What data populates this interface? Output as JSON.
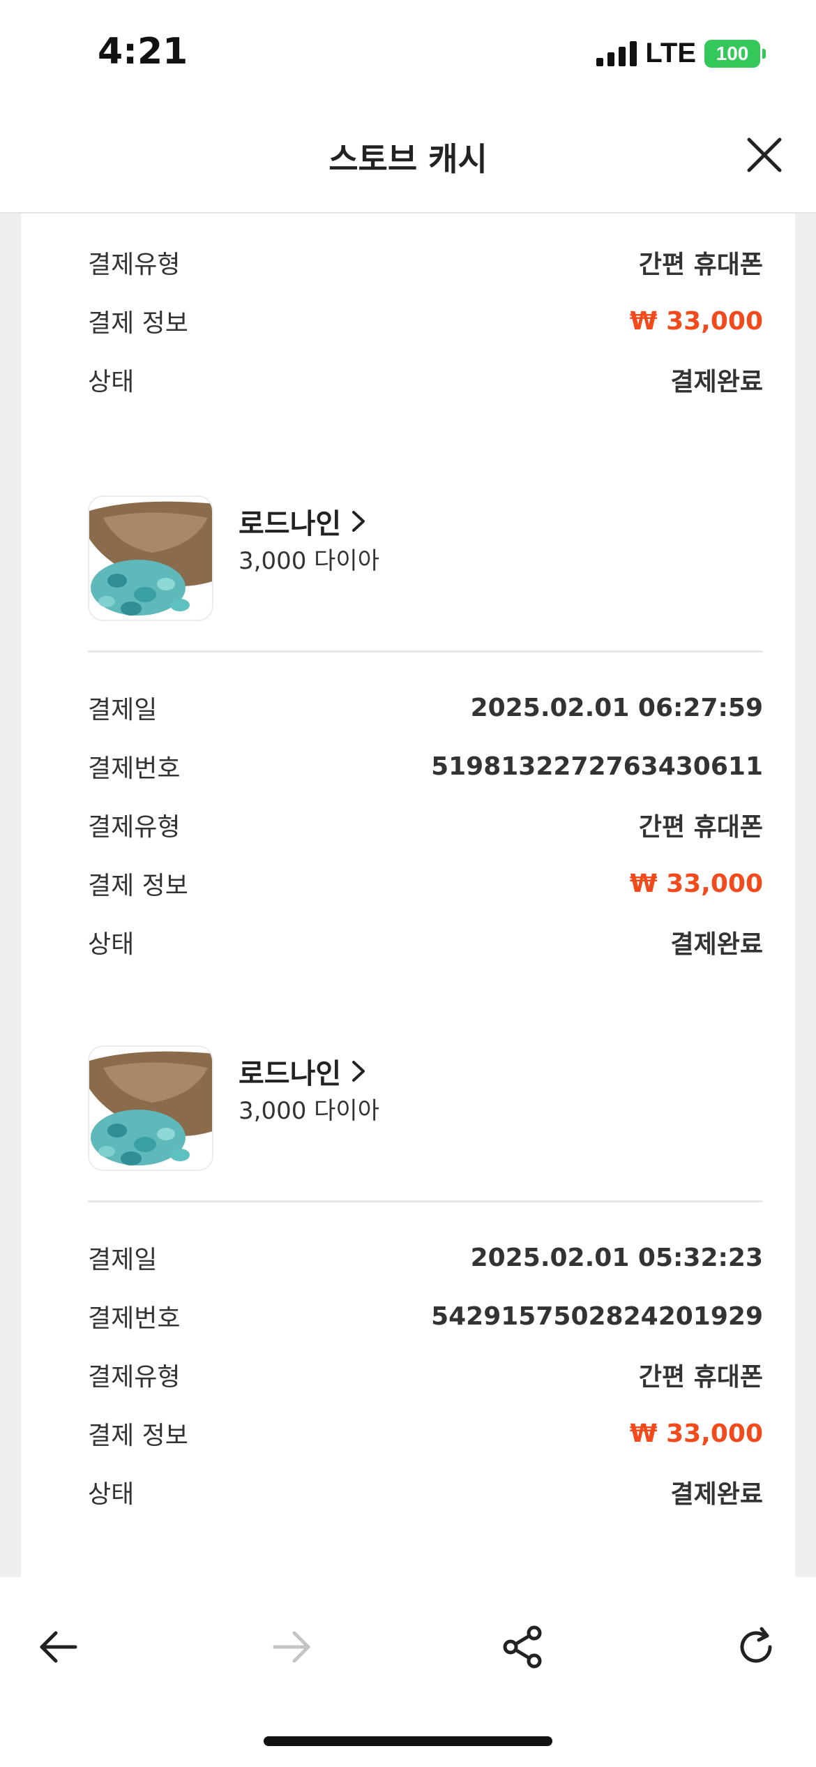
{
  "status_bar": {
    "time": "4:21",
    "network": "LTE",
    "battery": "100"
  },
  "header": {
    "title": "스토브 캐시"
  },
  "labels": {
    "date": "결제일",
    "number": "결제번호",
    "type": "결제유형",
    "info": "결제 정보",
    "status": "상태"
  },
  "partial_record": {
    "type": "간편 휴대폰",
    "info": "₩ 33,000",
    "status": "결제완료"
  },
  "records": [
    {
      "product_name": "로드나인",
      "product_desc": "3,000 다이아",
      "date": "2025.02.01 06:27:59",
      "number": "5198132272763430611",
      "type": "간편 휴대폰",
      "info": "₩ 33,000",
      "status": "결제완료"
    },
    {
      "product_name": "로드나인",
      "product_desc": "3,000 다이아",
      "date": "2025.02.01 05:32:23",
      "number": "5429157502824201929",
      "type": "간편 휴대폰",
      "info": "₩ 33,000",
      "status": "결제완료"
    }
  ],
  "icons": {
    "close": "close-icon",
    "back": "arrow-left-icon",
    "forward": "arrow-right-icon",
    "share": "share-icon",
    "refresh": "refresh-icon"
  },
  "colors": {
    "price": "#f04a1d",
    "battery": "#34c759"
  }
}
